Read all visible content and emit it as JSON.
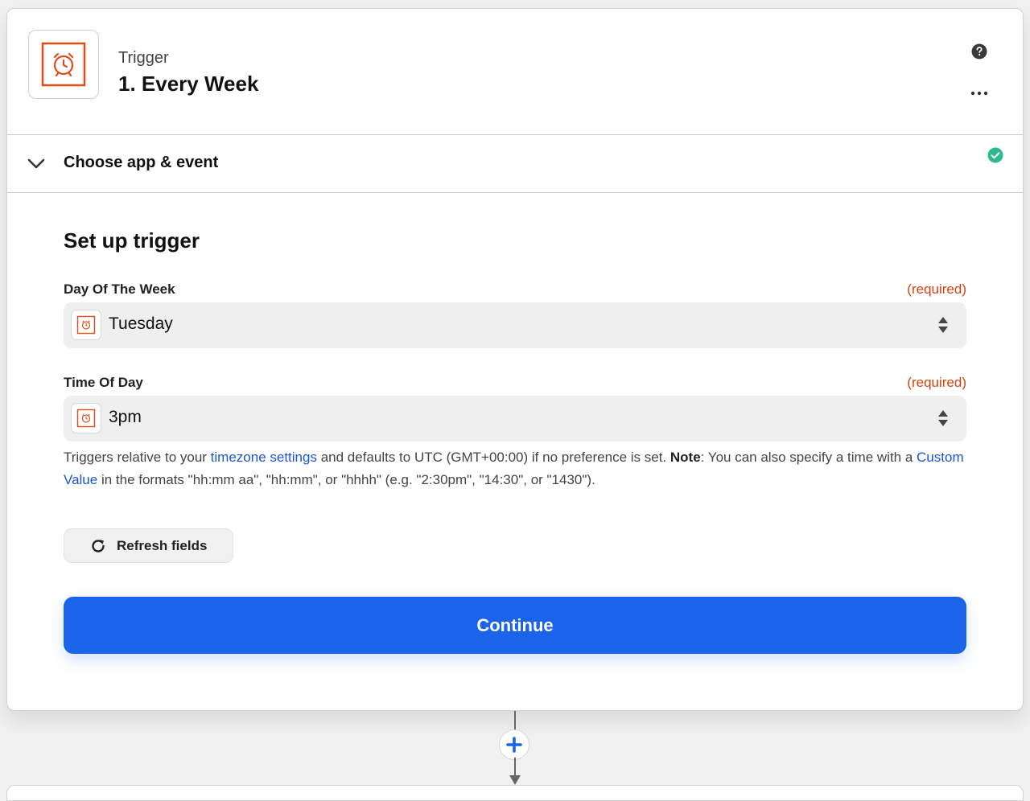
{
  "header": {
    "kicker": "Trigger",
    "title": "1. Every Week",
    "icon": "alarm-clock-icon",
    "icon_color": "#e04d1b"
  },
  "section": {
    "title": "Choose app & event",
    "status": "complete",
    "status_color": "#30b98e"
  },
  "setup": {
    "title": "Set up trigger",
    "fields": [
      {
        "label": "Day Of The Week",
        "required": "(required)",
        "value": "Tuesday"
      },
      {
        "label": "Time Of Day",
        "required": "(required)",
        "value": "3pm"
      }
    ],
    "help": {
      "p1": "Triggers relative to your ",
      "link1": "timezone settings",
      "p2": " and defaults to UTC (GMT+00:00) if no preference is set. ",
      "note": "Note",
      "p3": ": You can also specify a time with a ",
      "link2": "Custom Value",
      "p4": " in the formats \"hh:mm aa\", \"hh:mm\", or \"hhhh\" (e.g. \"2:30pm\", \"14:30\", or \"1430\")."
    },
    "refresh_label": "Refresh fields",
    "continue_label": "Continue"
  },
  "colors": {
    "accent": "#1b63e8",
    "required": "#d4420f",
    "link": "#1a56d6"
  }
}
